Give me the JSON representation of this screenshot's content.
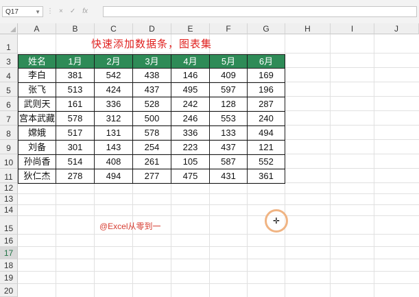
{
  "formula_bar": {
    "name_box": "Q17",
    "cancel_icon": "×",
    "enter_icon": "✓",
    "function_icon": "fx",
    "formula": ""
  },
  "columns": [
    "A",
    "B",
    "C",
    "D",
    "E",
    "F",
    "G",
    "H",
    "I",
    "J"
  ],
  "rows": [
    "1",
    "3",
    "4",
    "5",
    "6",
    "7",
    "8",
    "9",
    "10",
    "11",
    "12",
    "13",
    "14",
    "15",
    "16",
    "17",
    "18",
    "19",
    "20"
  ],
  "title": "快速添加数据条，图表集",
  "table": {
    "headers": [
      "姓名",
      "1月",
      "2月",
      "3月",
      "4月",
      "5月",
      "6月"
    ],
    "header_color": "#2e8b57",
    "rows": [
      [
        "李白",
        "381",
        "542",
        "438",
        "146",
        "409",
        "169"
      ],
      [
        "张飞",
        "513",
        "424",
        "437",
        "495",
        "597",
        "196"
      ],
      [
        "武则天",
        "161",
        "336",
        "528",
        "242",
        "128",
        "287"
      ],
      [
        "宫本武藏",
        "578",
        "312",
        "500",
        "246",
        "553",
        "240"
      ],
      [
        "嫦娥",
        "517",
        "131",
        "578",
        "336",
        "133",
        "494"
      ],
      [
        "刘备",
        "301",
        "143",
        "254",
        "223",
        "437",
        "121"
      ],
      [
        "孙尚香",
        "514",
        "408",
        "261",
        "105",
        "587",
        "552"
      ],
      [
        "狄仁杰",
        "278",
        "494",
        "277",
        "475",
        "431",
        "361"
      ]
    ]
  },
  "watermark": "@Excel从零到一",
  "selected_row": "17"
}
